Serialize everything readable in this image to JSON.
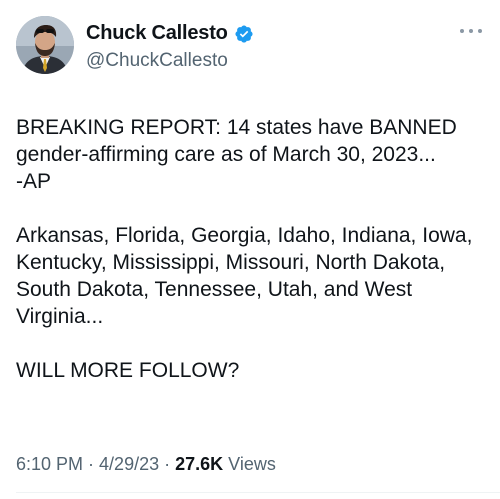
{
  "author": {
    "display_name": "Chuck Callesto",
    "handle": "@ChuckCallesto",
    "verified_icon": "verified-badge-icon",
    "avatar_icon": "avatar"
  },
  "tweet": {
    "paragraphs": [
      "BREAKING REPORT: 14 states have BANNED gender-affirming care as of March 30, 2023...\n-AP",
      "Arkansas, Florida, Georgia, Idaho, Indiana, Iowa, Kentucky, Mississippi, Missouri, North Dakota, South Dakota, Tennessee, Utah, and West Virginia...",
      "WILL MORE FOLLOW?"
    ]
  },
  "meta": {
    "time": "6:10 PM",
    "separator": "·",
    "date": "4/29/23",
    "views_count": "27.6K",
    "views_label": "Views"
  },
  "colors": {
    "text_primary": "#0f1419",
    "text_secondary": "#536471",
    "verified_blue": "#1d9bf0"
  }
}
